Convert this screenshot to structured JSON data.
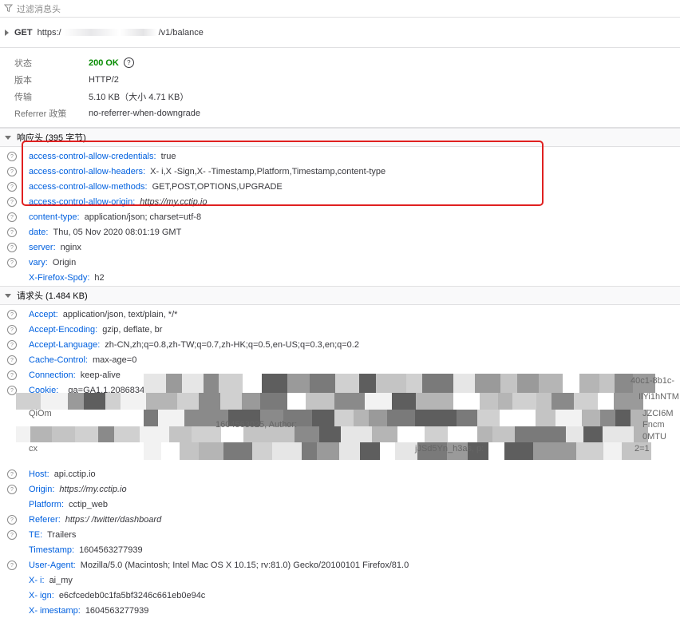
{
  "filter": {
    "placeholder": "过滤消息头"
  },
  "request": {
    "method": "GET",
    "url_prefix": "https:/",
    "url_suffix": "/v1/balance"
  },
  "summary": [
    {
      "label": "状态",
      "code": "200",
      "text": "OK"
    },
    {
      "label": "版本",
      "value": "HTTP/2"
    },
    {
      "label": "传输",
      "value": "5.10 KB（大小 4.71 KB）"
    },
    {
      "label": "Referrer 政策",
      "value": "no-referrer-when-downgrade"
    }
  ],
  "response_headers": {
    "title": "响应头 (395 字节)",
    "items": [
      {
        "name": "access-control-allow-credentials",
        "value": "true",
        "help": true
      },
      {
        "name": "access-control-allow-headers",
        "value": "X-      i,X      -Sign,X-      -Timestamp,Platform,Timestamp,content-type",
        "help": true
      },
      {
        "name": "access-control-allow-methods",
        "value": "GET,POST,OPTIONS,UPGRADE",
        "help": true
      },
      {
        "name": "access-control-allow-origin",
        "value": "https://my.cctip.io",
        "help": true,
        "italic": true
      },
      {
        "name": "content-type",
        "value": "application/json; charset=utf-8",
        "help": true
      },
      {
        "name": "date",
        "value": "Thu, 05 Nov 2020 08:01:19 GMT",
        "help": true
      },
      {
        "name": "server",
        "value": "nginx",
        "help": true
      },
      {
        "name": "vary",
        "value": "Origin",
        "help": true
      },
      {
        "name": "X-Firefox-Spdy",
        "value": "h2",
        "help": false
      }
    ]
  },
  "request_headers": {
    "title": "请求头 (1.484 KB)",
    "items": [
      {
        "name": "Accept",
        "value": "application/json, text/plain, */*",
        "help": true
      },
      {
        "name": "Accept-Encoding",
        "value": "gzip, deflate, br",
        "help": true
      },
      {
        "name": "Accept-Language",
        "value": "zh-CN,zh;q=0.8,zh-TW;q=0.7,zh-HK;q=0.5,en-US;q=0.3,en;q=0.2",
        "help": true
      },
      {
        "name": "Cache-Control",
        "value": "max-age=0",
        "help": true
      },
      {
        "name": "Connection",
        "value": "keep-alive",
        "help": true
      },
      {
        "name": "Cookie",
        "value": "_ga=GA1.1.2086834215.158",
        "help": true
      }
    ],
    "cookie_fragments": [
      "40c1-8b1c-",
      "IlYi1hNTM",
      "QiOm",
      "JZCI6M",
      "1604563025, Author:",
      "Fncm",
      "0MTU",
      "cx",
      "jJSd5Yn_h3as, p:",
      "2=1"
    ],
    "items_after": [
      {
        "name": "Host",
        "value": "api.cctip.io",
        "help": true
      },
      {
        "name": "Origin",
        "value": "https://my.cctip.io",
        "help": true,
        "italic": true
      },
      {
        "name": "Platform",
        "value": "cctip_web",
        "help": false
      },
      {
        "name": "Referer",
        "value": "https:/               /twitter/dashboard",
        "help": true,
        "italic": true
      },
      {
        "name": "TE",
        "value": "Trailers",
        "help": true
      },
      {
        "name": "Timestamp",
        "value": "1604563277939",
        "help": false
      },
      {
        "name": "User-Agent",
        "value": "Mozilla/5.0 (Macintosh; Intel Mac OS X 10.15; rv:81.0) Gecko/20100101 Firefox/81.0",
        "help": true
      },
      {
        "name": "X-      i",
        "value": "ai_my",
        "help": false
      },
      {
        "name": "X-      ign",
        "value": "e6cfcedeb0c1fa5bf3246c661eb0e94c",
        "help": false
      },
      {
        "name": "X-      imestamp",
        "value": "1604563277939",
        "help": false
      }
    ]
  },
  "colors": {
    "header_name": "#0060df",
    "status_ok": "#058b00",
    "highlight": "#e02020"
  }
}
